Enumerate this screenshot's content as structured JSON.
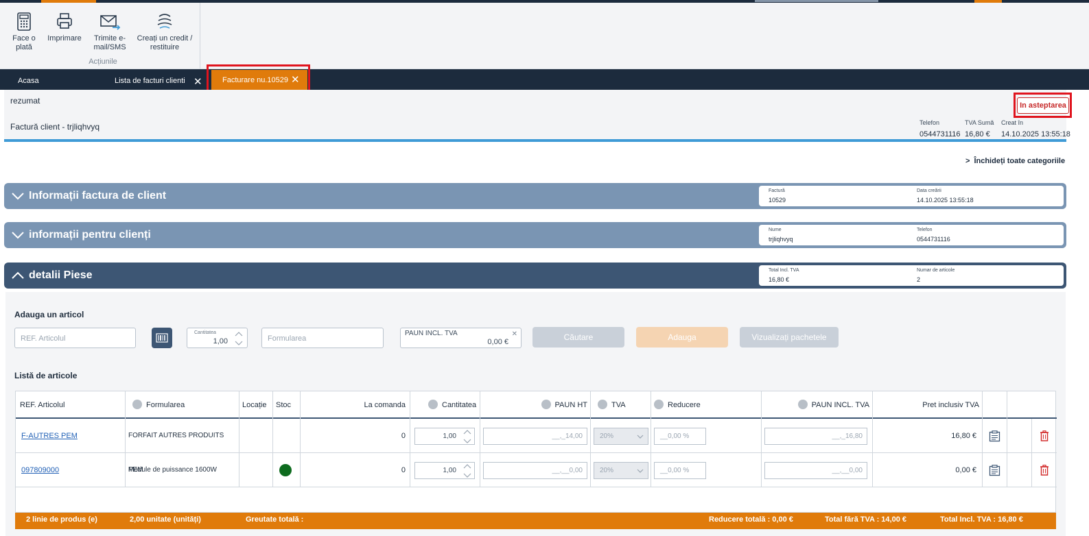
{
  "ribbon": {
    "buttons": [
      {
        "label": "Face o plată",
        "icon": "payment-icon"
      },
      {
        "label": "Imprimare",
        "icon": "printer-icon"
      },
      {
        "label": "Trimite e-mail/SMS",
        "icon": "mail-send-icon"
      },
      {
        "label": "Creați un credit / restituire",
        "icon": "credit-refund-icon"
      }
    ],
    "group_caption": "Acțiunile"
  },
  "tabs": {
    "home": "Acasa",
    "list": "Lista de facturi clienti",
    "active": "Facturare nu.10529",
    "close_glyph": "✕"
  },
  "summary": {
    "title": "rezumat",
    "invoice_title": "Factură client - trjliqhvyq",
    "status": "In asteptarea",
    "phone_label": "Telefon",
    "phone_value": "0544731116",
    "vat_label": "TVA Sumă",
    "vat_value": "16,80 €",
    "created_label": "Creat în",
    "created_value": "14.10.2025 13:55:18"
  },
  "close_all": "Închideți toate categoriile",
  "close_all_glyph": ">",
  "sections": [
    {
      "title": "Informații factura de client",
      "c1_label": "Factură",
      "c1_value": "10529",
      "c2_label": "Data creării",
      "c2_value": "14.10.2025 13:55:18"
    },
    {
      "title": "informații pentru clienți",
      "c1_label": "Nume",
      "c1_value": "trjliqhvyq",
      "c2_label": "Telefon",
      "c2_value": "0544731116"
    },
    {
      "title": "detalii Piese",
      "c1_label": "Total Incl. TVA",
      "c1_value": "16,80 €",
      "c2_label": "Numar de articole",
      "c2_value": "2"
    }
  ],
  "add_article": {
    "heading": "Adauga un articol",
    "ref_placeholder": "REF. Articolul",
    "qty_label": "Cantitatea",
    "qty_value": "1,00",
    "formulation_placeholder": "Formularea",
    "price_label": "PAUN INCL. TVA",
    "price_value": "0,00 €",
    "search_button": "Căutare",
    "add_button": "Adauga",
    "packages_button": "Vizualizați pachetele"
  },
  "article_list": {
    "heading": "Listă de articole",
    "columns": [
      "REF. Articolul",
      "Formularea",
      "Locație",
      "Stoc",
      "La comanda",
      "Cantitatea",
      "PAUN HT",
      "TVA",
      "Reducere",
      "PAUN INCL. TVA",
      "Pret inclusiv TVA"
    ],
    "rows": [
      {
        "ref": "F-AUTRES PEM",
        "formulation": "FORFAIT AUTRES PRODUITS PEM",
        "location": "",
        "stock": "",
        "on_order": "0",
        "qty": "1,00",
        "price_ht": "__,_14,00",
        "vat": "20%",
        "discount": "__0,00 %",
        "price_incl": "__,_16,80",
        "total_incl": "16,80 €"
      },
      {
        "ref": "097809000",
        "formulation": "Module de puissance 1600W",
        "location": "",
        "stock": "in-stock",
        "on_order": "0",
        "qty": "1,00",
        "price_ht": "__,__0,00",
        "vat": "20%",
        "discount": "__0,00 %",
        "price_incl": "__,__0,00",
        "total_incl": "0,00 €"
      }
    ]
  },
  "footer": {
    "lines": "2  linie de produs (e)",
    "units": "2,00  unitate (unități)",
    "weight": "Greutate totală :",
    "discount": "Reducere totală : 0,00 €",
    "total_ht": "Total fără TVA : 14,00 €",
    "total_incl": "Total Incl. TVA : 16,80 €"
  },
  "colors": {
    "accent": "#e07b0b",
    "navy": "#1c2b3d",
    "section_light": "#7a95b3",
    "section_dark": "#3d5674",
    "status_red": "#c62828",
    "stock_green": "#0d6b1e"
  }
}
